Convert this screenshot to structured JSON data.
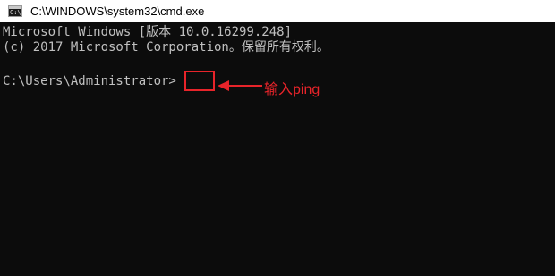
{
  "window": {
    "title": "C:\\WINDOWS\\system32\\cmd.exe",
    "icon": "cmd-icon"
  },
  "console": {
    "lines": [
      "Microsoft Windows [版本 10.0.16299.248]",
      "(c) 2017 Microsoft Corporation。保留所有权利。",
      "",
      "C:\\Users\\Administrator>"
    ]
  },
  "annotation": {
    "text": "输入ping",
    "color": "#e8242a"
  },
  "colors": {
    "console_bg": "#0c0c0c",
    "console_fg": "#c0c0c0"
  }
}
